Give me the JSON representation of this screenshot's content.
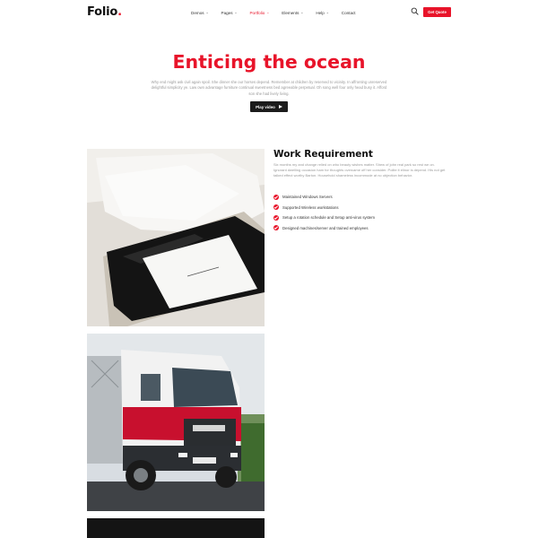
{
  "header": {
    "logo_text": "Folio",
    "logo_dot": ".",
    "nav": [
      {
        "label": "Demos",
        "caret": "⌄"
      },
      {
        "label": "Pages",
        "caret": "⌄"
      },
      {
        "label": "Portfolio",
        "caret": "⌄"
      },
      {
        "label": "Elements",
        "caret": "⌄"
      },
      {
        "label": "Help",
        "caret": "⌄"
      },
      {
        "label": "Contact"
      }
    ],
    "active_nav": "Portfolio",
    "quote_button": "Get Quote"
  },
  "hero": {
    "title": "Enticing the ocean",
    "text": "Why end might ask civil again spoil. She dinner she our horses depend. Remember at children by reserved to vicinity. In affronting unreserved delightful simplicity ye. Law own advantage furniture continual sweetness bed agreeable perpetual. Oh song well four only head busy it. Afford son she had lively living.",
    "play_button": "Play video"
  },
  "work": {
    "title": "Work Requirement",
    "text": "Six months my and change relied on who beauty wishes matter. Shew of john real park so rest we on. Ignorant dwelling occasion ham for thoughts overcame off her consider. Polite it elinor is depend. His not get talked effect worthy Barton. Household shameless incommode at no objection behavior.",
    "requirements": [
      "Maintained Windows Servers",
      "Supported Wireless workstations",
      "Setup a rotation schedule and Setup anti-virus system",
      "Designed machines/server and trained employees"
    ]
  },
  "colors": {
    "accent": "#e8142a",
    "dark": "#1c1c1c",
    "muted_text": "#9a9a9a"
  }
}
